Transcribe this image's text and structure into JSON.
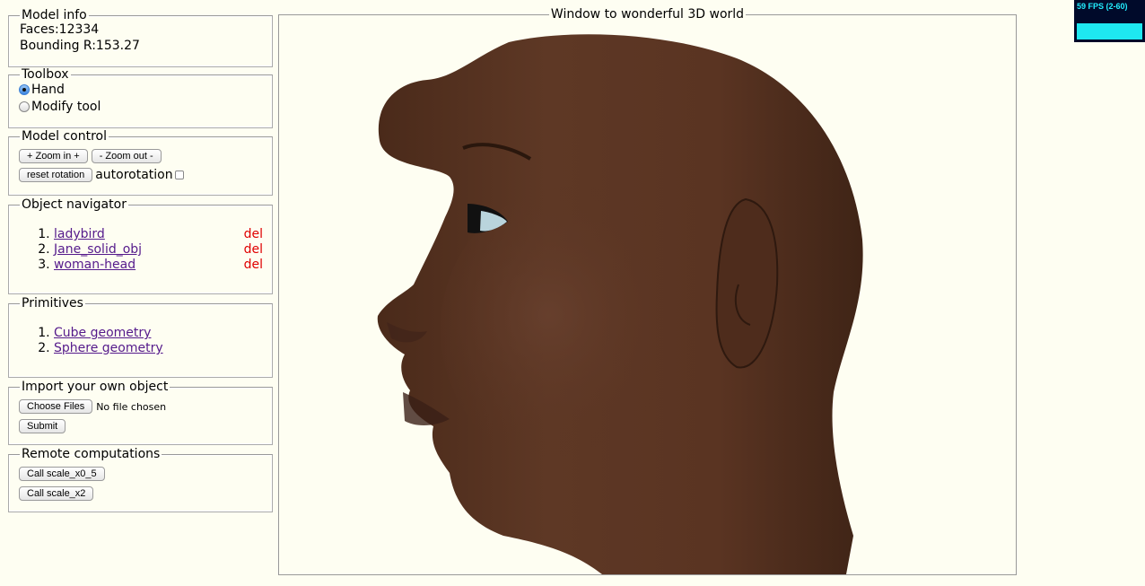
{
  "model_info": {
    "legend": "Model info",
    "faces": "Faces:12334",
    "bounding": "Bounding R:153.27"
  },
  "toolbox": {
    "legend": "Toolbox",
    "options": [
      {
        "label": "Hand",
        "selected": true
      },
      {
        "label": "Modify tool",
        "selected": false
      }
    ]
  },
  "model_control": {
    "legend": "Model control",
    "zoom_in": "+ Zoom in +",
    "zoom_out": "- Zoom out -",
    "reset_rotation": "reset rotation",
    "autorotation_label": "autorotation",
    "autorotation_checked": false
  },
  "object_navigator": {
    "legend": "Object navigator",
    "items": [
      {
        "name": "ladybird",
        "delete": "del"
      },
      {
        "name": "Jane_solid_obj",
        "delete": "del"
      },
      {
        "name": "woman-head",
        "delete": "del"
      }
    ]
  },
  "primitives": {
    "legend": "Primitives",
    "items": [
      "Cube geometry",
      "Sphere geometry"
    ]
  },
  "import": {
    "legend": "Import your own object",
    "choose_files": "Choose Files",
    "no_file": "No file chosen",
    "submit": "Submit"
  },
  "remote": {
    "legend": "Remote computations",
    "buttons": [
      "Call scale_x0_5",
      "Call scale_x2"
    ]
  },
  "viewport": {
    "legend": "Window to wonderful 3D world"
  },
  "fps_meter": {
    "text": "59 FPS (2-60)",
    "color": "#22eeff"
  },
  "colors": {
    "page_bg": "#fefef2",
    "link": "#551a8b",
    "delete": "#e00000",
    "skin": "#5a3422"
  }
}
